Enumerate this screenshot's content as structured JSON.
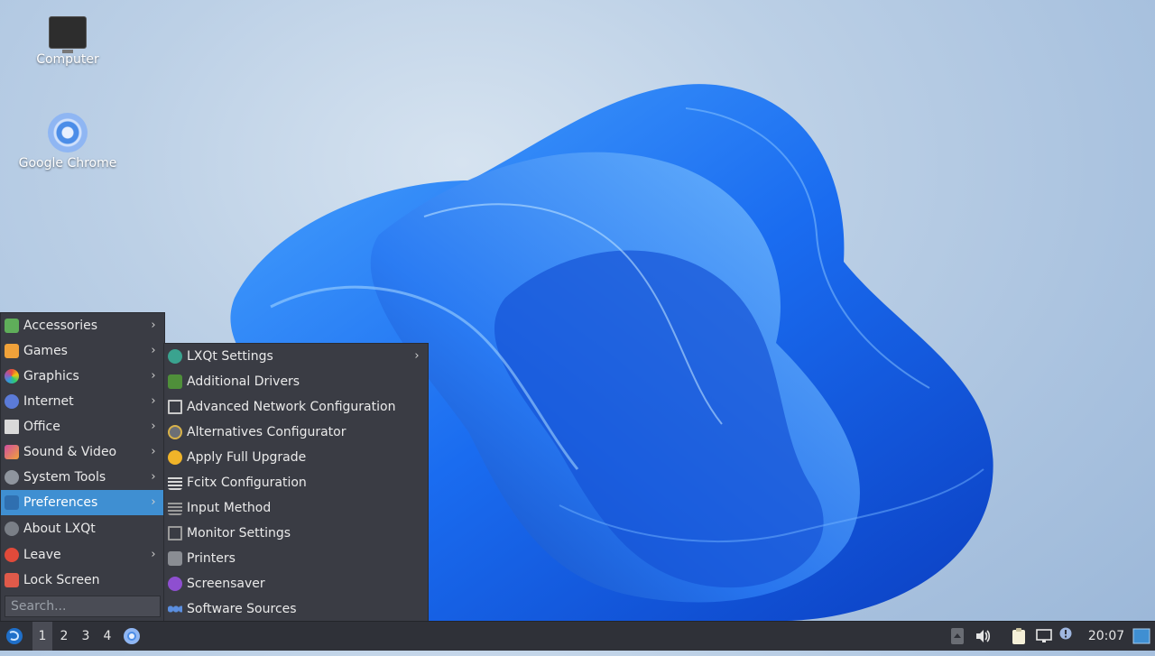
{
  "desktop": {
    "icons": [
      {
        "label": "Computer",
        "icon": "monitor-icon"
      },
      {
        "label": "Google Chrome",
        "icon": "chrome-icon"
      }
    ]
  },
  "main_menu": {
    "items": [
      {
        "label": "Accessories",
        "icon": "accessories-icon",
        "has_submenu": true
      },
      {
        "label": "Games",
        "icon": "games-icon",
        "has_submenu": true
      },
      {
        "label": "Graphics",
        "icon": "graphics-icon",
        "has_submenu": true
      },
      {
        "label": "Internet",
        "icon": "internet-icon",
        "has_submenu": true
      },
      {
        "label": "Office",
        "icon": "office-icon",
        "has_submenu": true
      },
      {
        "label": "Sound & Video",
        "icon": "sound-video-icon",
        "has_submenu": true
      },
      {
        "label": "System Tools",
        "icon": "system-tools-icon",
        "has_submenu": true
      },
      {
        "label": "Preferences",
        "icon": "preferences-icon",
        "has_submenu": true,
        "active": true
      },
      {
        "label": "About LXQt",
        "icon": "about-icon",
        "has_submenu": false
      },
      {
        "label": "Leave",
        "icon": "leave-icon",
        "has_submenu": true
      },
      {
        "label": "Lock Screen",
        "icon": "lock-icon",
        "has_submenu": false
      }
    ],
    "search_placeholder": "Search..."
  },
  "preferences_submenu": {
    "items": [
      {
        "label": "LXQt Settings",
        "icon": "lxqt-settings-icon",
        "has_submenu": true
      },
      {
        "label": "Additional Drivers",
        "icon": "chip-icon",
        "has_submenu": false
      },
      {
        "label": "Advanced Network Configuration",
        "icon": "network-monitor-icon",
        "has_submenu": false
      },
      {
        "label": "Alternatives Configurator",
        "icon": "alternatives-icon",
        "has_submenu": false
      },
      {
        "label": "Apply Full Upgrade",
        "icon": "upgrade-icon",
        "has_submenu": false
      },
      {
        "label": "Fcitx Configuration",
        "icon": "keyboard-icon",
        "has_submenu": false
      },
      {
        "label": "Input Method",
        "icon": "input-method-icon",
        "has_submenu": false
      },
      {
        "label": "Monitor Settings",
        "icon": "display-icon",
        "has_submenu": false
      },
      {
        "label": "Printers",
        "icon": "printer-icon",
        "has_submenu": false
      },
      {
        "label": "Screensaver",
        "icon": "screensaver-icon",
        "has_submenu": false
      },
      {
        "label": "Software Sources",
        "icon": "software-sources-icon",
        "has_submenu": false
      }
    ]
  },
  "taskbar": {
    "workspaces": [
      "1",
      "2",
      "3",
      "4"
    ],
    "active_workspace": "1",
    "clock": "20:07"
  },
  "colors": {
    "menu_bg": "#3a3c44",
    "highlight": "#3f8fd2",
    "taskbar_bg": "#2f3138"
  }
}
